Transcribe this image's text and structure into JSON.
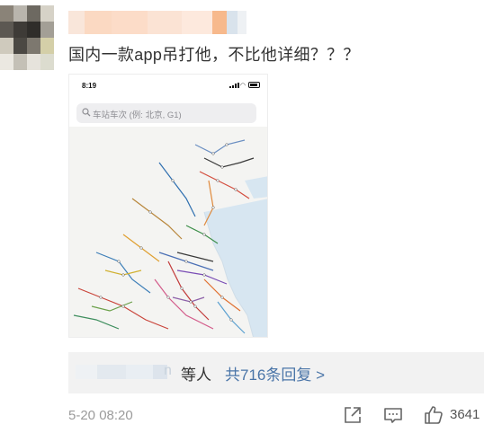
{
  "comment": {
    "text": "国内一款app吊打他，不比他详细？？？"
  },
  "screenshot": {
    "status_time": "8:19",
    "search_placeholder": "车站车次 (例: 北京, G1)"
  },
  "replies": {
    "name_tail": "n",
    "others": "等人",
    "link": "共716条回复 >"
  },
  "meta": {
    "timestamp": "5-20 08:20",
    "like_count": "3641"
  },
  "icons": {
    "forward": "share-icon",
    "comment": "comment-icon",
    "like": "thumbs-up-icon",
    "search": "search-icon"
  },
  "colors": {
    "link": "#4a75a8",
    "replies_bg": "#f2f2f2",
    "muted": "#9b9b9b",
    "text": "#333333",
    "username_highlight": "#fbd9c2"
  }
}
